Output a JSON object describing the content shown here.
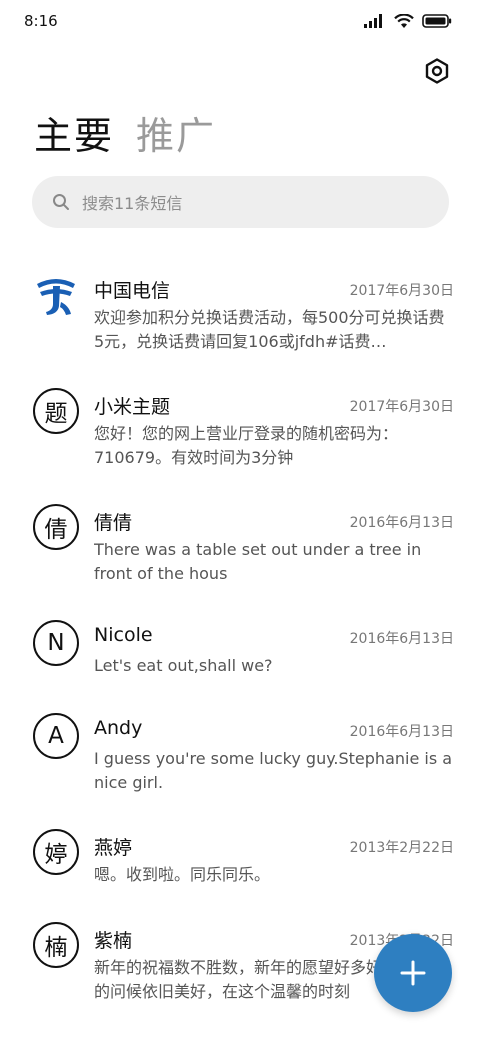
{
  "status_bar": {
    "time": "8:16"
  },
  "tabs": [
    {
      "label": "主要",
      "active": true
    },
    {
      "label": "推广",
      "active": false
    }
  ],
  "search": {
    "placeholder": "搜索11条短信"
  },
  "messages": [
    {
      "name": "中国电信",
      "date": "2017年6月30日",
      "preview": "欢迎参加积分兑换话费活动，每500分可兑换话费5元，兑换话费请回复106或jfdh#话费…",
      "avatar": "china-telecom-logo"
    },
    {
      "name": "小米主题",
      "date": "2017年6月30日",
      "preview": "您好！您的网上营业厅登录的随机密码为：710679。有效时间为3分钟",
      "avatar": "题"
    },
    {
      "name": "倩倩",
      "date": "2016年6月13日",
      "preview": "There was a table set out under a tree in front of the hous",
      "avatar": "倩"
    },
    {
      "name": "Nicole",
      "date": "2016年6月13日",
      "preview": "Let's eat out,shall we?",
      "avatar": "N"
    },
    {
      "name": "Andy",
      "date": "2016年6月13日",
      "preview": "I guess you're some lucky guy.Stephanie is a nice girl.",
      "avatar": "A"
    },
    {
      "name": "燕婷",
      "date": "2013年2月22日",
      "preview": "嗯。收到啦。同乐同乐。",
      "avatar": "婷"
    },
    {
      "name": "紫楠",
      "date": "2013年2月22日",
      "preview": "新年的祝福数不胜数，新年的愿望好多好多，新年的问候依旧美好，在这个温馨的时刻",
      "avatar": "楠"
    }
  ],
  "colors": {
    "fab": "#2e7fc1",
    "telecom_logo": "#1a5fb4"
  },
  "icons": {
    "settings": "settings-icon",
    "search": "search-icon",
    "compose": "plus-icon"
  }
}
